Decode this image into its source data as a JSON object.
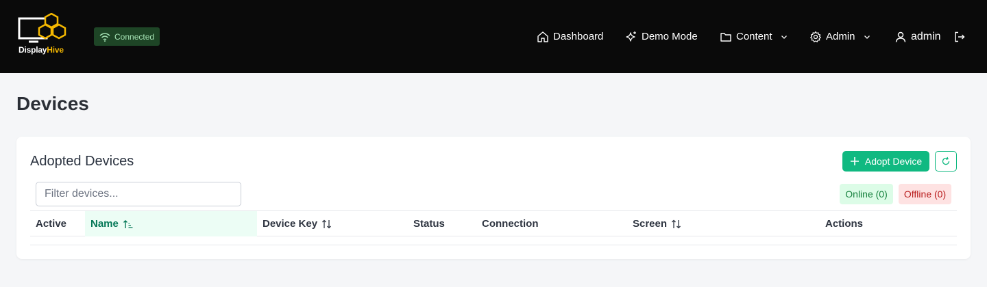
{
  "app": {
    "brand_part1": "Display",
    "brand_part2": "Hive",
    "connection_status": "Connected"
  },
  "nav": {
    "dashboard": "Dashboard",
    "demo_mode": "Demo Mode",
    "content": "Content",
    "admin": "Admin",
    "user": "admin"
  },
  "page": {
    "title": "Devices"
  },
  "card": {
    "title": "Adopted Devices",
    "adopt_button": "Adopt Device",
    "filter_placeholder": "Filter devices...",
    "online_label": "Online (0)",
    "offline_label": "Offline (0)"
  },
  "table": {
    "columns": [
      "Active",
      "Name",
      "Device Key",
      "Status",
      "Connection",
      "Screen",
      "Actions"
    ],
    "sorted_column": "Name",
    "rows": []
  },
  "colors": {
    "accent": "#10b981",
    "topbar": "#0a0a0a",
    "brand_yellow": "#f5b800"
  },
  "icons": {
    "dashboard": "home-icon",
    "demo_mode": "sparkles-icon",
    "content": "folder-icon",
    "admin": "gear-icon",
    "user": "user-icon",
    "logout": "logout-icon",
    "refresh": "refresh-icon",
    "add": "plus-icon",
    "wifi": "wifi-icon"
  }
}
